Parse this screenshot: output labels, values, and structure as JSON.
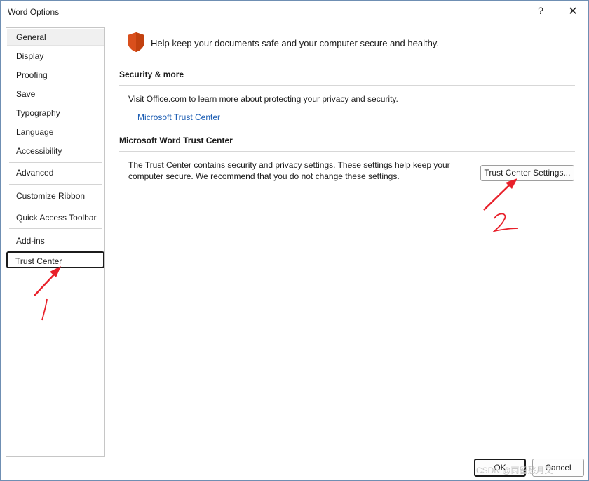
{
  "window": {
    "title": "Word Options",
    "help_label": "?",
    "close_label": "✕"
  },
  "sidebar": {
    "items": [
      {
        "label": "General"
      },
      {
        "label": "Display"
      },
      {
        "label": "Proofing"
      },
      {
        "label": "Save"
      },
      {
        "label": "Typography"
      },
      {
        "label": "Language"
      },
      {
        "label": "Accessibility"
      },
      {
        "label": "Advanced"
      },
      {
        "label": "Customize Ribbon"
      },
      {
        "label": "Quick Access Toolbar"
      },
      {
        "label": "Add-ins"
      },
      {
        "label": "Trust Center"
      }
    ],
    "selected": "Trust Center"
  },
  "main": {
    "intro": "Help keep your documents safe and your computer secure and healthy.",
    "security_section": {
      "heading": "Security & more",
      "text": "Visit Office.com to learn more about protecting your privacy and security.",
      "link": "Microsoft Trust Center"
    },
    "trust_section": {
      "heading": "Microsoft Word Trust Center",
      "text_line1": "The Trust Center contains security and privacy settings. These settings help keep your",
      "text_line2": "computer secure. We recommend that you do not change these settings.",
      "button": "Trust Center Settings..."
    }
  },
  "footer": {
    "ok": "OK",
    "cancel": "Cancel"
  },
  "watermark": "CSDN @雨留愁月又",
  "colors": {
    "shield": "#d94f1c",
    "link": "#1a5cb3",
    "annotation": "#e8202a"
  },
  "icons": {
    "shield": "shield-icon",
    "help": "help-icon",
    "close": "close-icon"
  }
}
